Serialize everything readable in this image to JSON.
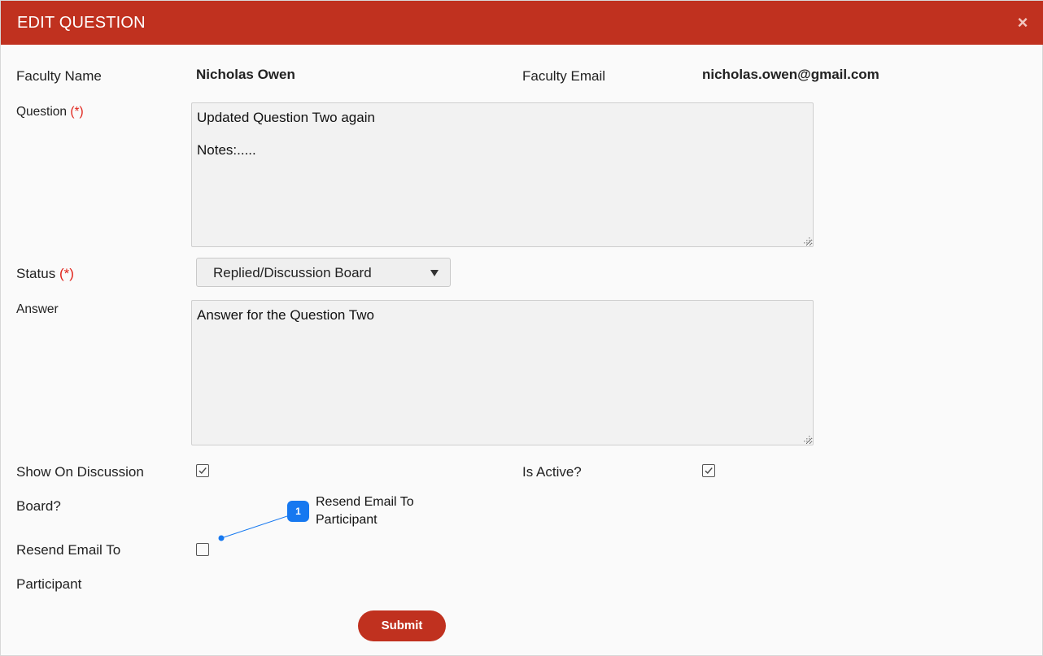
{
  "header": {
    "title": "EDIT QUESTION",
    "close_label": "×"
  },
  "faculty": {
    "name_label": "Faculty Name",
    "name_value": "Nicholas Owen",
    "email_label": "Faculty Email",
    "email_value": "nicholas.owen@gmail.com"
  },
  "question": {
    "label": "Question",
    "required_mark": "(*)",
    "lines": [
      "Updated Question Two again",
      "Notes:....."
    ]
  },
  "status": {
    "label": "Status",
    "required_mark": "(*)",
    "selected": "Replied/Discussion Board"
  },
  "answer": {
    "label": "Answer",
    "value": "Answer for the Question Two"
  },
  "show_on_board": {
    "label_line1": "Show On Discussion",
    "label_line2": "Board?",
    "checked": true
  },
  "is_active": {
    "label": "Is Active?",
    "checked": true
  },
  "resend_email": {
    "label_line1": "Resend Email To",
    "label_line2": "Participant",
    "checked": false
  },
  "callout": {
    "number": "1",
    "text_line1": "Resend Email To",
    "text_line2": "Participant"
  },
  "submit": {
    "label": "Submit"
  },
  "colors": {
    "brand": "#c0311f",
    "callout": "#1678f0",
    "required": "#e0231a"
  }
}
